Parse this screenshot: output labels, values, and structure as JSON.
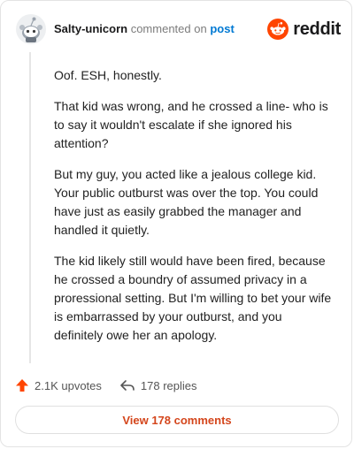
{
  "header": {
    "username": "Salty-unicorn",
    "action_text": "commented on",
    "post_link": "post",
    "brand": "reddit"
  },
  "comment": {
    "paragraphs": [
      "Oof. ESH, honestly.",
      "That kid was wrong, and he crossed a line- who is to say it wouldn't escalate if she ignored his attention?",
      "But my guy, you acted like a jealous college kid. Your public outburst was over the top. You could have just as easily grabbed the manager and handled it quietly.",
      "The kid likely still would have been fired, because he crossed a boundry of assumed privacy in a proressional setting. But I'm willing to bet your wife is embarrassed by your outburst, and you definitely owe her an apology."
    ]
  },
  "footer": {
    "upvotes": "2.1K upvotes",
    "replies": "178 replies",
    "view_comments": "View 178 comments"
  },
  "colors": {
    "accent": "#ff4500",
    "link": "#0079d3",
    "button_text": "#d4461c"
  },
  "icons": {
    "avatar": "snoo-avatar-icon",
    "brand": "reddit-logo-icon",
    "upvote": "upvote-arrow-icon",
    "reply": "reply-arrow-icon"
  }
}
